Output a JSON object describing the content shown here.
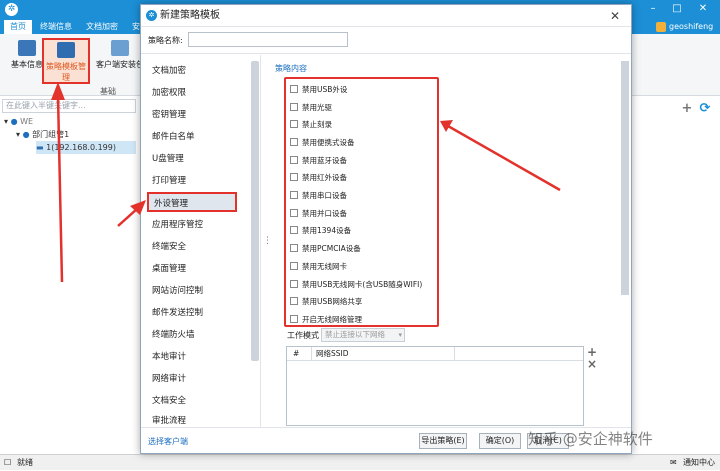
{
  "app": {
    "tabs": [
      "首页",
      "终端信息",
      "文档加密",
      "安"
    ],
    "user_name": "geoshifeng",
    "ribbon": {
      "buttons": [
        "基本信息",
        "策略模板管理",
        "客户端安装包"
      ],
      "group_label": "基础"
    },
    "search_placeholder": "在此键入半键关键字...",
    "tree": {
      "root_label": "WE",
      "dept_label": "部门组管1",
      "device_label": "1(192.168.0.199)"
    },
    "status": {
      "left": "就绪",
      "right": "通知中心"
    },
    "colors": {
      "accent": "#1c8fd6",
      "highlight": "#e3322c",
      "selected_nav": "#dfe6ee"
    }
  },
  "dialog": {
    "title": "新建策略模板",
    "close_glyph": "✕",
    "name_label": "策略名称:",
    "name_value": "",
    "nav_items": [
      "文档加密",
      "加密权限",
      "密钥管理",
      "邮件白名单",
      "U盘管理",
      "打印管理",
      "外设管理",
      "应用程序管控",
      "终端安全",
      "桌面管理",
      "网站访问控制",
      "邮件发送控制",
      "终端防火墙",
      "本地审计",
      "网络审计",
      "文档安全",
      "审批流程"
    ],
    "selected_nav": "外设管理",
    "content_title": "策略内容",
    "options": [
      "禁用USB外设",
      "禁用光驱",
      "禁止刻录",
      "禁用便携式设备",
      "禁用蓝牙设备",
      "禁用红外设备",
      "禁用串口设备",
      "禁用并口设备",
      "禁用1394设备",
      "禁用PCMCIA设备",
      "禁用无线网卡",
      "禁用USB无线网卡(含USB随身WIFI)",
      "禁用USB网络共享",
      "开启无线网络管理"
    ],
    "work_mode_label": "工作模式",
    "work_mode_value": "禁止连接以下网络",
    "ssid_table": {
      "columns": [
        "#",
        "网络SSID"
      ],
      "rows": []
    },
    "footer": {
      "link": "选择客户端",
      "export_button": "导出策略(E)",
      "ok_button": "确定(O)",
      "cancel_button": "取消(C)"
    }
  },
  "watermark": "知乎 @安企神软件"
}
